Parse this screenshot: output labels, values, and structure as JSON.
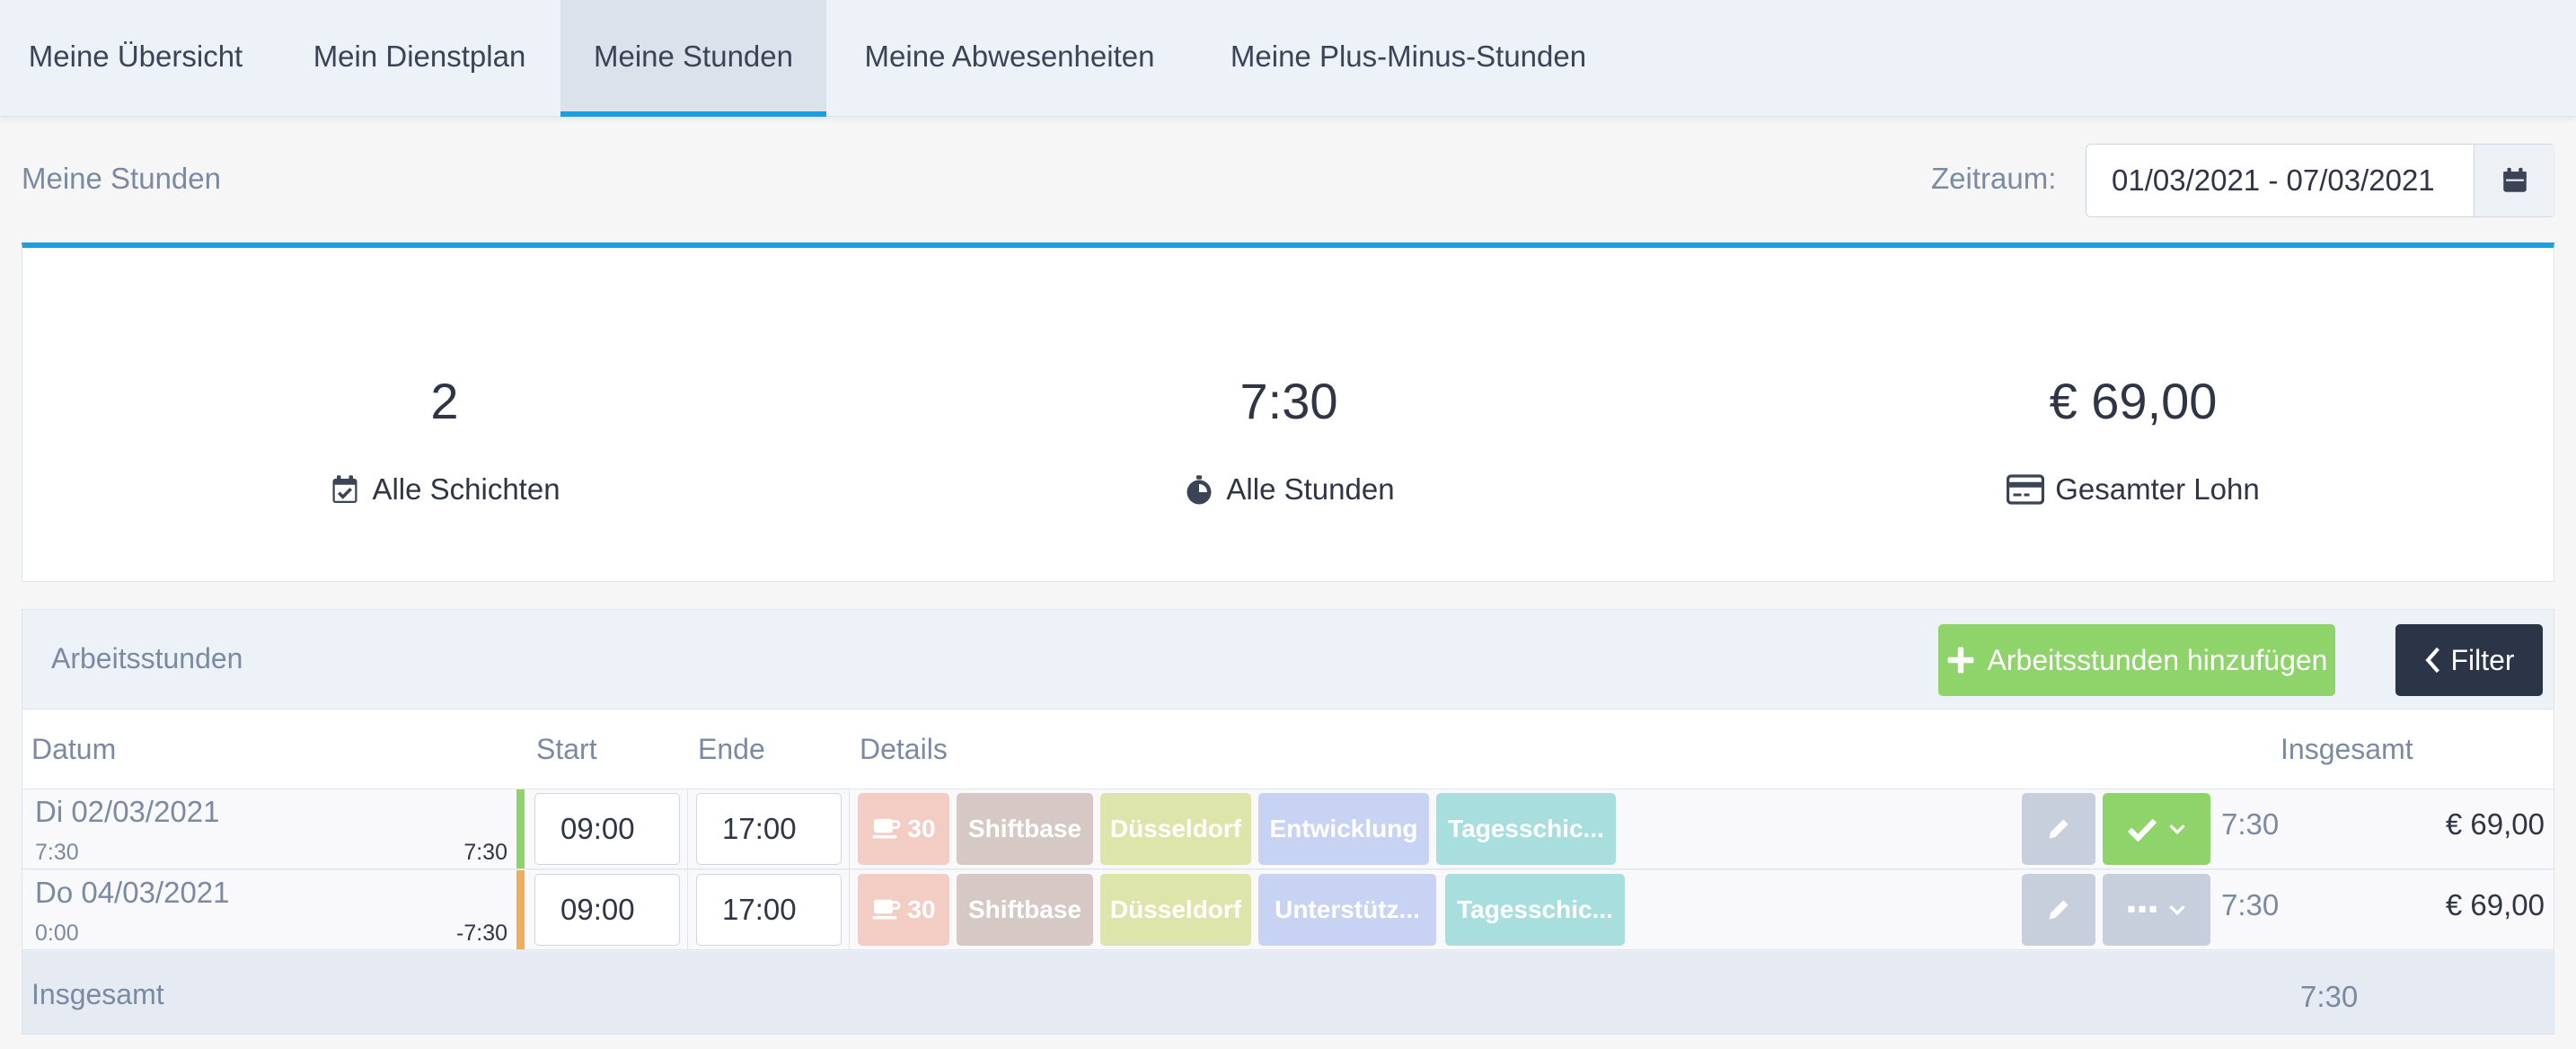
{
  "nav": {
    "tabs": [
      {
        "label": "Meine Übersicht"
      },
      {
        "label": "Mein Dienstplan"
      },
      {
        "label": "Meine Stunden"
      },
      {
        "label": "Meine Abwesenheiten"
      },
      {
        "label": "Meine Plus-Minus-Stunden"
      }
    ],
    "active_tab": "Meine Stunden"
  },
  "header": {
    "title": "Meine Stunden",
    "range_label": "Zeitraum:",
    "range_value": "01/03/2021 - 07/03/2021"
  },
  "stats": [
    {
      "value": "2",
      "label": "Alle Schichten",
      "icon": "calendar-check-icon"
    },
    {
      "value": "7:30",
      "label": "Alle Stunden",
      "icon": "stopwatch-icon"
    },
    {
      "value": "€ 69,00",
      "label": "Gesamter Lohn",
      "icon": "credit-card-icon"
    }
  ],
  "hours": {
    "title": "Arbeitsstunden",
    "add_label": "Arbeitsstunden hinzufügen",
    "filter_label": "Filter",
    "columns": {
      "date": "Datum",
      "start": "Start",
      "end": "Ende",
      "details": "Details",
      "total": "Insgesamt"
    },
    "rows": [
      {
        "date": "Di 02/03/2021",
        "planned": "7:30",
        "diff": "7:30",
        "status_color": "#8fd36b",
        "start": "09:00",
        "end": "17:00",
        "break": "30",
        "tags": [
          "Shiftbase",
          "Düsseldorf",
          "Entwicklung",
          "Tagesschic..."
        ],
        "status": "approved",
        "total": "7:30",
        "wage": "€ 69,00"
      },
      {
        "date": "Do 04/03/2021",
        "planned": "0:00",
        "diff": "-7:30",
        "status_color": "#f0ad5a",
        "start": "09:00",
        "end": "17:00",
        "break": "30",
        "tags": [
          "Shiftbase",
          "Düsseldorf",
          "Unterstütz...",
          "Tagesschic..."
        ],
        "status": "pending",
        "total": "7:30",
        "wage": "€ 69,00"
      }
    ],
    "footer_label": "Insgesamt",
    "footer_total": "7:30"
  },
  "colors": {
    "accent": "#1e9ee0",
    "add_button": "#8fd36b",
    "filter_button": "#2c3447",
    "tag_company": "#d6c8c4",
    "tag_location": "#dde5ab",
    "tag_department": "#c8d3f3",
    "tag_shift": "#a9dedf",
    "tag_break": "#f3cdc4"
  }
}
